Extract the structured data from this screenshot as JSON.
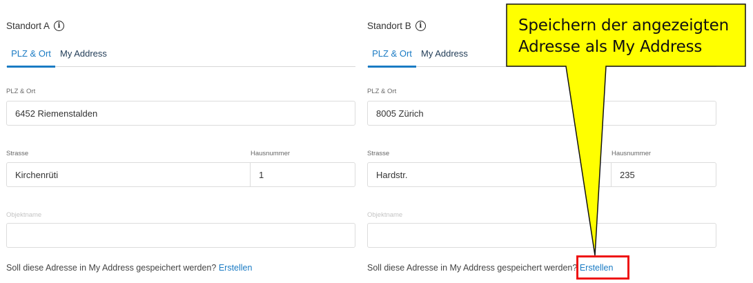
{
  "standort_a": {
    "title": "Standort A",
    "tabs": [
      "PLZ & Ort",
      "My Address"
    ],
    "plz_ort_label": "PLZ & Ort",
    "plz_ort_value": "6452 Riemenstalden",
    "strasse_label": "Strasse",
    "strasse_value": "Kirchenrüti",
    "hausnummer_label": "Hausnummer",
    "hausnummer_value": "1",
    "objektname_label": "Objektname",
    "objektname_value": "",
    "footer_question": "Soll diese Adresse in My Address gespeichert werden?",
    "footer_link": "Erstellen"
  },
  "standort_b": {
    "title": "Standort B",
    "tabs": [
      "PLZ & Ort",
      "My Address"
    ],
    "plz_ort_label": "PLZ & Ort",
    "plz_ort_value": "8005 Zürich",
    "strasse_label": "Strasse",
    "strasse_value": "Hardstr.",
    "hausnummer_label": "Hausnummer",
    "hausnummer_value": "235",
    "objektname_label": "Objektname",
    "objektname_value": "",
    "footer_question": "Soll diese Adresse in My Address gespeichert werden?",
    "footer_link": "Erstellen"
  },
  "callout": {
    "text_line1": "Speichern der angezeigten",
    "text_line2": "Adresse als My Address",
    "fill_color": "#ffff00",
    "highlight_color": "#ee1111"
  },
  "icons": {
    "info": "info-icon"
  },
  "colors": {
    "accent": "#1a7bc4",
    "border": "#dcdcdc"
  }
}
